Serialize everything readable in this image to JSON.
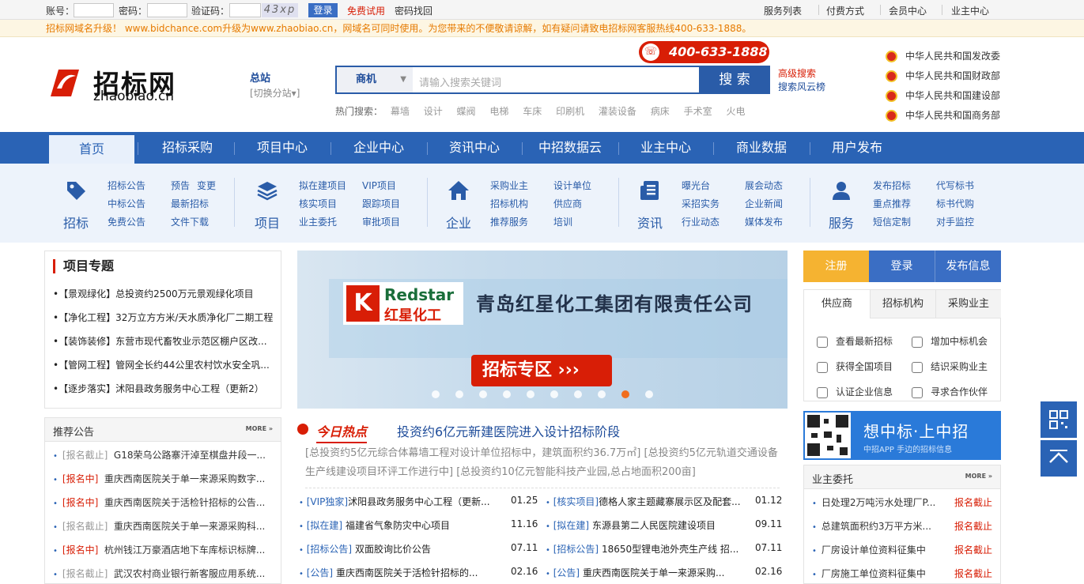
{
  "topbar": {
    "account_label": "账号：",
    "password_label": "密码：",
    "captcha_label": "验证码：",
    "captcha_text": "43xp",
    "login_button": "登录",
    "free_trial": "免费试用",
    "forgot_password": "密码找回",
    "links": [
      "服务列表",
      "付费方式",
      "会员中心",
      "业主中心"
    ]
  },
  "notice": "招标网域名升级！ www.bidchance.com升级为www.zhaobiao.cn，网域名可同时使用。为您带来的不便敬请谅解，如有疑问请致电招标网客服热线400-633-1888。",
  "header": {
    "logo_cn": "招标网",
    "logo_en": "zhaobiao.cn",
    "site_main": "总站",
    "site_switch": "[切换分站▾]",
    "hotline": "400-633-1888",
    "search_select": "商机",
    "search_placeholder": "请输入搜索关键词",
    "search_button": "搜 索",
    "advanced_search": "高级搜索",
    "search_rank": "搜索风云榜",
    "hot_label": "热门搜索：",
    "hot_terms": [
      "幕墙",
      "设计",
      "蝶阀",
      "电梯",
      "车床",
      "印刷机",
      "灌装设备",
      "病床",
      "手术室",
      "火电"
    ],
    "gov_links": [
      "中华人民共和国发改委",
      "中华人民共和国财政部",
      "中华人民共和国建设部",
      "中华人民共和国商务部"
    ]
  },
  "main_nav": [
    "首页",
    "招标采购",
    "项目中心",
    "企业中心",
    "资讯中心",
    "中招数据云",
    "业主中心",
    "商业数据",
    "用户发布"
  ],
  "sub_nav": [
    {
      "caption": "招标",
      "icon": "tag-icon",
      "links": [
        "招标公告",
        "预告",
        "变更",
        "中标公告",
        "最新招标",
        "免费公告",
        "文件下载"
      ]
    },
    {
      "caption": "项目",
      "icon": "layers-icon",
      "links": [
        "拟在建项目",
        "VIP项目",
        "核实项目",
        "跟踪项目",
        "业主委托",
        "审批项目"
      ]
    },
    {
      "caption": "企业",
      "icon": "home-icon",
      "links": [
        "采购业主",
        "设计单位",
        "招标机构",
        "供应商",
        "推荐服务",
        "培训"
      ]
    },
    {
      "caption": "资讯",
      "icon": "document-icon",
      "links": [
        "曝光台",
        "展会动态",
        "采招实务",
        "企业新闻",
        "行业动态",
        "媒体发布"
      ]
    },
    {
      "caption": "服务",
      "icon": "user-icon",
      "links": [
        "发布招标",
        "代写标书",
        "重点推荐",
        "标书代购",
        "短信定制",
        "对手监控"
      ]
    }
  ],
  "project_topics": {
    "title": "项目专题",
    "items": [
      "•【景观绿化】总投资约2500万元景观绿化项目",
      "•【净化工程】32万立方方米/天水质净化厂二期工程",
      "•【装饰装修】东营市现代畜牧业示范区棚户区改...",
      "•【管网工程】管网全长约44公里农村饮水安全巩...",
      "•【逐步落实】沭阳县政务服务中心工程（更新2）"
    ]
  },
  "banner": {
    "brand_en": "Redstar",
    "brand_cn": "红星化工",
    "company": "青岛红星化工集团有限责任公司",
    "zone": "招标专区 ›››"
  },
  "right_buttons": [
    "注册",
    "登录",
    "发布信息"
  ],
  "right_tabs": {
    "tabs": [
      "供应商",
      "招标机构",
      "采购业主"
    ],
    "options": [
      "查看最新招标",
      "增加中标机会",
      "获得全国项目",
      "结识采购业主",
      "认证企业信息",
      "寻求合作伙伴"
    ]
  },
  "app": {
    "line1": "想中标·上中招",
    "line2": "中招APP  手边的招标信息"
  },
  "recommend": {
    "title": "推荐公告",
    "more": "MORE »",
    "rows": [
      {
        "tag": "[报名截止]",
        "text": "G18荣乌公路寨汗淖至棋盘井段一..."
      },
      {
        "tag": "[报名中]",
        "text": "重庆西南医院关于单一来源采购数字..."
      },
      {
        "tag": "[报名中]",
        "text": "重庆西南医院关于活检针招标的公告..."
      },
      {
        "tag": "[报名截止]",
        "text": "重庆西南医院关于单一来源采购科..."
      },
      {
        "tag": "[报名中]",
        "text": "杭州钱江万豪酒店地下车库标识标牌..."
      },
      {
        "tag": "[报名截止]",
        "text": "武汉农村商业银行新客服应用系统..."
      }
    ]
  },
  "hot_today": {
    "label": "今日热点",
    "title": "投资约6亿元新建医院进入设计招标阶段",
    "summary": "[总投资约5亿元综合体幕墙工程对设计单位招标中，建筑面积约36.7万㎡] [总投资约5亿元轨道交通设备生产线建设项目环评工作进行中] [总投资约10亿元智能科技产业园,总占地面积200亩]"
  },
  "news_list": [
    {
      "tag": "[VIP独家]",
      "text": "沭阳县政务服务中心工程（更新...",
      "date": "01.25"
    },
    {
      "tag": "[核实项目]",
      "text": "德格人家主题藏寨展示区及配套...",
      "date": "01.12"
    },
    {
      "tag": "[拟在建]",
      "text": "福建省气象防灾中心项目",
      "date": "11.16"
    },
    {
      "tag": "[拟在建]",
      "text": "东源县第二人民医院建设项目",
      "date": "09.11"
    },
    {
      "tag": "[招标公告]",
      "text": "双面胶询比价公告",
      "date": "07.11"
    },
    {
      "tag": "[招标公告]",
      "text": "18650型锂电池外壳生产线 招...",
      "date": "07.11"
    },
    {
      "tag": "[公告]",
      "text": "重庆西南医院关于活检针招标的...",
      "date": "02.16"
    },
    {
      "tag": "[公告]",
      "text": "重庆西南医院关于单一来源采购...",
      "date": "02.16"
    }
  ],
  "owner_entrust": {
    "title": "业主委托",
    "more": "MORE »",
    "rows": [
      {
        "text": "日处理2万吨污水处理厂P...",
        "status": "报名截止"
      },
      {
        "text": "总建筑面积约3万平方米...",
        "status": "报名截止"
      },
      {
        "text": "厂房设计单位资料征集中",
        "status": "报名截止"
      },
      {
        "text": "厂房施工单位资料征集中",
        "status": "报名截止"
      }
    ]
  },
  "colors": {
    "brand_blue": "#2a63b5",
    "accent_red": "#d81e06",
    "notice_orange": "#e67a00",
    "register_yellow": "#f5b331"
  }
}
